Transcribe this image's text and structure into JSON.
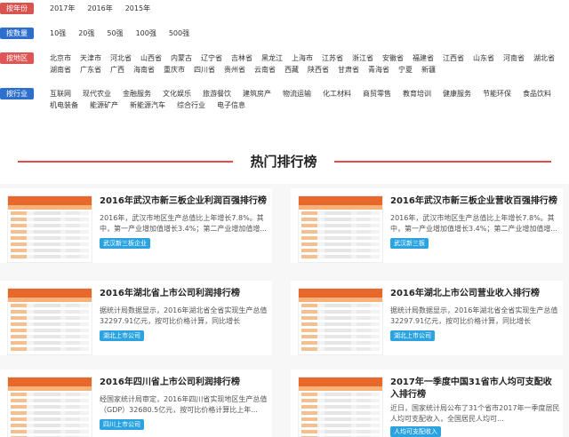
{
  "filters": {
    "year": {
      "label": "按年份",
      "options": [
        "2017年",
        "2016年",
        "2015年"
      ]
    },
    "count": {
      "label": "按数量",
      "options": [
        "10强",
        "20强",
        "50强",
        "100强",
        "500强"
      ]
    },
    "region": {
      "label": "按地区",
      "options": [
        "北京市",
        "天津市",
        "河北省",
        "山西省",
        "内蒙古",
        "辽宁省",
        "吉林省",
        "黑龙江",
        "上海市",
        "江苏省",
        "浙江省",
        "安徽省",
        "福建省",
        "江西省",
        "山东省",
        "河南省",
        "湖北省",
        "湖南省",
        "广东省",
        "广西",
        "海南省",
        "重庆市",
        "四川省",
        "贵州省",
        "云南省",
        "西藏",
        "陕西省",
        "甘肃省",
        "青海省",
        "宁夏",
        "新疆"
      ]
    },
    "industry": {
      "label": "按行业",
      "options": [
        "互联网",
        "现代农业",
        "金融服务",
        "文化娱乐",
        "旅游餐饮",
        "建筑房产",
        "物流运输",
        "化工材料",
        "商贸零售",
        "教育培训",
        "健康服务",
        "节能环保",
        "食品饮料",
        "机电装备",
        "能源矿产",
        "新能源汽车",
        "综合行业",
        "电子信息"
      ]
    }
  },
  "section_title": "热门排行榜",
  "cards": [
    {
      "title": "2016年武汉市新三板企业利润百强排行榜",
      "desc": "2016年，武汉市地区生产总值比上年增长7.8%。其中，第一产业增加值增长3.4%；第二产业增加值增...",
      "tag": "武汉新三板企业"
    },
    {
      "title": "2016年武汉市新三板企业营收百强排行榜",
      "desc": "2016年，武汉市地区生产总值比上年增长7.8%。其中，第一产业增加值增长3.4%；第二产业增加值增...",
      "tag": "武汉新三板"
    },
    {
      "title": "2016年湖北省上市公司利润排行榜",
      "desc": "据统计局数据显示，2016年湖北省全省实现生产总值32297.91亿元，按可比价格计算，同比增长8.1%，...",
      "tag": "湖北上市公司"
    },
    {
      "title": "2016年湖北上市公司营业收入排行榜",
      "desc": "据统计局数据显示，2016年湖北省全省实现生产总值32297.91亿元，按可比价格计算，同比增长8.1%，...",
      "tag": "湖北上市公司"
    },
    {
      "title": "2016年四川省上市公司利润排行榜",
      "desc": "经国家统计局审定，2016年四川省实现地区生产总值（GDP）32680.5亿元，按可比价格计算比上年...",
      "tag": "四川上市公司"
    },
    {
      "title": "2017年一季度中国31省市人均可支配收入排行榜",
      "desc": "近日，国家统计局公布了31个省市2017年一季度居民人均可支配收入，全国居民人均可...",
      "tag": "人均可支配收入"
    }
  ]
}
